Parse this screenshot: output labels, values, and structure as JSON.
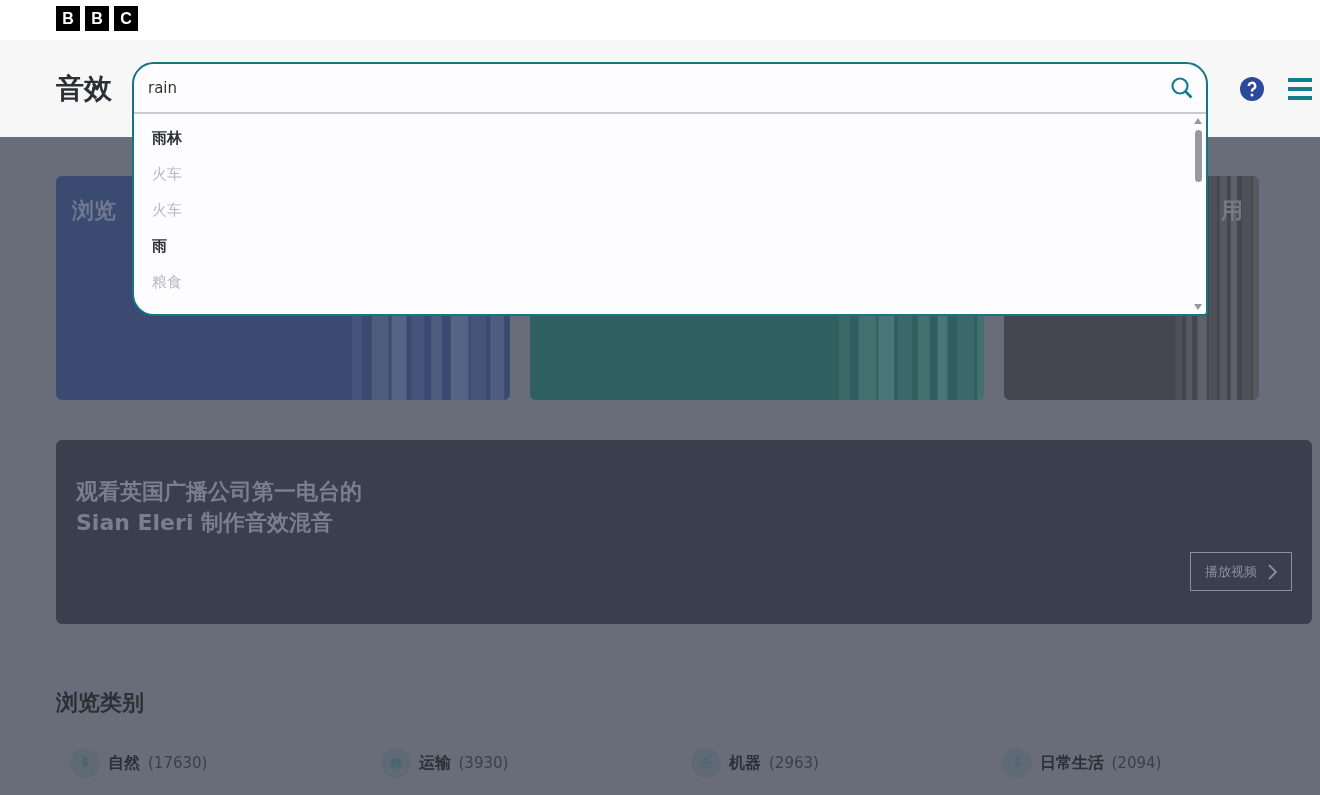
{
  "brand": {
    "letters": [
      "B",
      "B",
      "C"
    ]
  },
  "header": {
    "title": "音效"
  },
  "search": {
    "value": "rain",
    "expanded": true
  },
  "suggestions": [
    {
      "label": "雨林",
      "dimmed": false
    },
    {
      "label": "火车",
      "dimmed": true
    },
    {
      "label": "火车",
      "dimmed": true
    },
    {
      "label": "雨",
      "dimmed": false
    },
    {
      "label": "粮食",
      "dimmed": true
    }
  ],
  "cards": [
    {
      "title": "浏览",
      "color": "#3a4a70"
    },
    {
      "color": "#2f605f"
    },
    {
      "title": "用",
      "color": "#44474f"
    }
  ],
  "banner": {
    "lines": [
      "观看英国广播公司第一电台的",
      "Sian Eleri 制作音效混音"
    ],
    "button": "播放视频"
  },
  "categories_heading": "浏览类别",
  "categories": [
    {
      "kind": "nature",
      "name": "自然",
      "count": "(17630)"
    },
    {
      "kind": "transport",
      "name": "运输",
      "count": "(3930)"
    },
    {
      "kind": "machine",
      "name": "机器",
      "count": "(2963)"
    },
    {
      "kind": "daily",
      "name": "日常生活",
      "count": "(2094)"
    }
  ]
}
